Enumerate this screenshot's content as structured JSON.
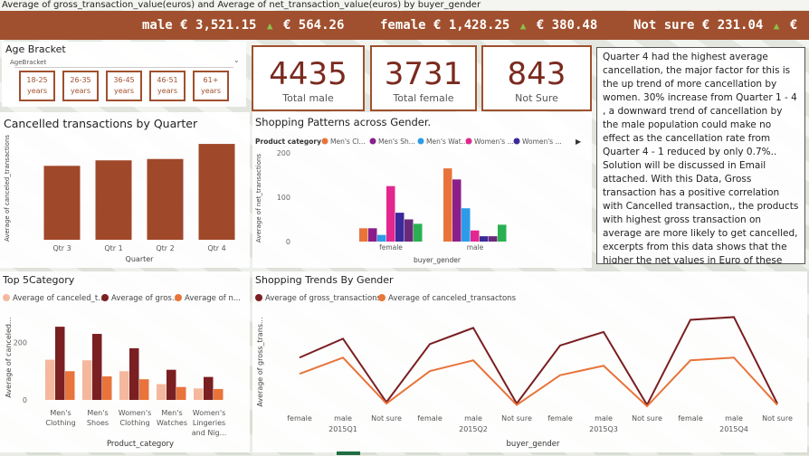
{
  "header": {
    "title": "Average of gross_transaction_value(euros) and Average of net_transaction_value(euros) by buyer_gender",
    "ticker": [
      {
        "gender": "male",
        "gross": "€ 3,521.15",
        "net": "€ 564.26"
      },
      {
        "gender": "female",
        "gross": "€ 1,428.25",
        "net": "€ 380.48"
      },
      {
        "gender": "Not sure",
        "gross": "€ 231.04",
        "net": "€"
      }
    ]
  },
  "slicer": {
    "title": "Age Bracket",
    "field": "AgeBracket",
    "options": [
      {
        "line1": "18-25",
        "line2": "years"
      },
      {
        "line1": "26-35",
        "line2": "years"
      },
      {
        "line1": "36-45",
        "line2": "years"
      },
      {
        "line1": "46-51",
        "line2": "years"
      },
      {
        "line1": "61+",
        "line2": "years"
      }
    ]
  },
  "cards": [
    {
      "value": "4435",
      "label": "Total male"
    },
    {
      "value": "3731",
      "label": "Total female"
    },
    {
      "value": "843",
      "label": "Not Sure"
    }
  ],
  "note": {
    "text": "Quarter 4 had the highest average cancellation, the major factor for this is the up trend of more cancellation by women. 30% increase from Quarter 1 - 4 , a downward trend of cancellation by the male population could make no effect as the cancellation rate from Quarter 4 - 1 reduced by only 0.7%.. Solution will be discussed in Email attached. With this Data, Gross transaction has a positive correlation with Cancelled transaction,, the products with highest gross transaction on average are more likely to get cancelled, excerpts from this data shows that the higher the net values in Euro of these products the higher their cancellation rate"
  },
  "colors": {
    "accent": "#a0502e",
    "dark": "#7a2a1e",
    "orange": "#e8743b",
    "pink": "#f4b89e"
  },
  "chart_data": [
    {
      "id": "quarter",
      "type": "bar",
      "title": "Cancelled transactions by Quarter",
      "xlabel": "Quarter",
      "ylabel": "Average of canceled_transactions",
      "categories": [
        "Qtr 3",
        "Qtr 1",
        "Qtr 2",
        "Qtr 4"
      ],
      "values": [
        27,
        29,
        29.5,
        35
      ],
      "ylim": [
        0,
        38
      ]
    },
    {
      "id": "gender",
      "type": "bar",
      "title": "Shopping Patterns across Gender.",
      "legend_title": "Product category",
      "legend": [
        "Men's Cl...",
        "Men's Sh...",
        "Men's Wat...",
        "Women's ...",
        "Women's ..."
      ],
      "xlabel": "buyer_gender",
      "ylabel": "Average of net_transactions",
      "categories": [
        "female",
        "male"
      ],
      "series": [
        {
          "name": "Men's Clothing",
          "color": "#e8743b",
          "values": [
            30,
            165
          ]
        },
        {
          "name": "Men's Shoes",
          "color": "#8a1f8a",
          "values": [
            30,
            140
          ]
        },
        {
          "name": "Men's Watches",
          "color": "#2d9be8",
          "values": [
            15,
            75
          ]
        },
        {
          "name": "Women's Clothing",
          "color": "#e3278f",
          "values": [
            125,
            25
          ]
        },
        {
          "name": "Women's Lingeries",
          "color": "#3a2a9a",
          "values": [
            65,
            12
          ]
        },
        {
          "name": "Women's Shoes",
          "color": "#6a2a7a",
          "values": [
            50,
            12
          ]
        },
        {
          "name": "Women's Watches",
          "color": "#2ab052",
          "values": [
            40,
            38
          ]
        }
      ],
      "yticks": [
        0,
        100,
        200
      ],
      "ylim": [
        0,
        210
      ]
    },
    {
      "id": "top5",
      "type": "bar",
      "title": "Top 5Category",
      "legend": [
        "Average of canceled_t...",
        "Average of gros...",
        "Average of n..."
      ],
      "xlabel": "Product_category",
      "ylabel": "Average of canceled...",
      "categories": [
        "Men's Clothing",
        "Men's Shoes",
        "Women's Clothing",
        "Men's Watches",
        "Women's Lingeries and Nig..."
      ],
      "category_lines": [
        [
          "Men's",
          "Clothing"
        ],
        [
          "Men's",
          "Shoes"
        ],
        [
          "Women's",
          "Clothing"
        ],
        [
          "Men's",
          "Watches"
        ],
        [
          "Women's",
          "Lingeries",
          "and Nig..."
        ]
      ],
      "series": [
        {
          "name": "Average of canceled_transactions",
          "color": "#f4b89e",
          "values": [
            140,
            138,
            100,
            55,
            40
          ]
        },
        {
          "name": "Average of gross_transactions",
          "color": "#7a1f22",
          "values": [
            255,
            230,
            180,
            105,
            80
          ]
        },
        {
          "name": "Average of net_transactions",
          "color": "#e8743b",
          "values": [
            100,
            82,
            72,
            45,
            38
          ]
        }
      ],
      "yticks": [
        0,
        200
      ],
      "ylim": [
        0,
        290
      ]
    },
    {
      "id": "trends",
      "type": "line",
      "title": "Shopping Trends By Gender",
      "legend": [
        "Average of gross_transactions",
        "Average of canceled_transactons"
      ],
      "xlabel": "buyer_gender",
      "ylabel": "Average of gross_trans...",
      "categories": [
        "female",
        "male",
        "Not sure",
        "female",
        "male",
        "Not sure",
        "female",
        "male",
        "Not sure",
        "female",
        "male",
        "Not sure"
      ],
      "groups": [
        "2015Q1",
        "2015Q2",
        "2015Q3",
        "2015Q4"
      ],
      "series": [
        {
          "name": "Average of gross_transactions",
          "color": "#7a1f22",
          "values": [
            38,
            52,
            5,
            48,
            60,
            4,
            47,
            57,
            3,
            66,
            68,
            4
          ]
        },
        {
          "name": "Average of canceled_transactons",
          "color": "#e8743b",
          "values": [
            26,
            38,
            4,
            28,
            36,
            3,
            25,
            32,
            2,
            36,
            38,
            3
          ]
        }
      ],
      "ylim": [
        0,
        75
      ]
    }
  ]
}
